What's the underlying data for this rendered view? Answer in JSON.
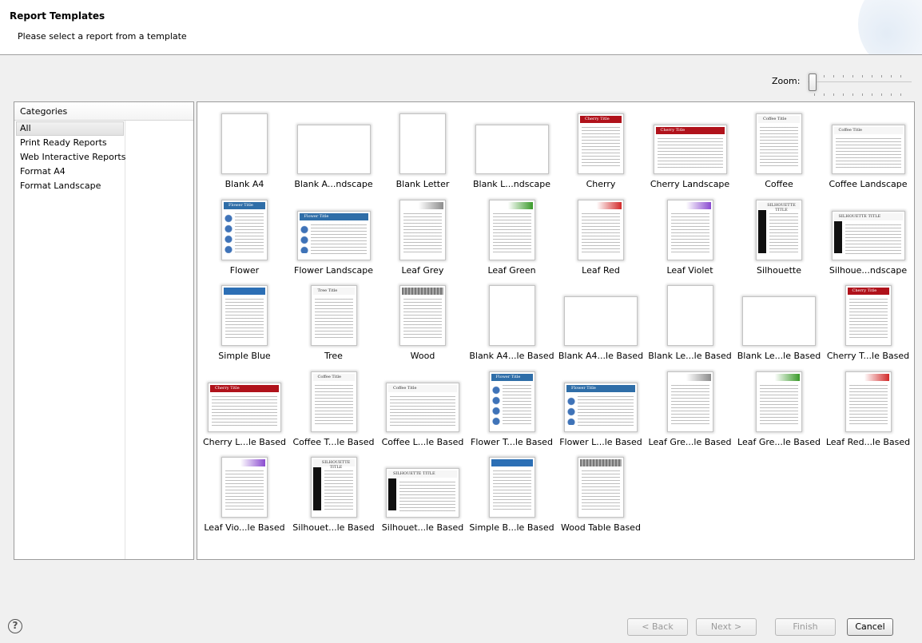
{
  "header": {
    "title": "Report Templates",
    "subtitle": "Please select a report from a template"
  },
  "zoom": {
    "label": "Zoom:",
    "level": 0
  },
  "categories": {
    "header": "Categories",
    "selected": "All",
    "items": [
      "All",
      "Print Ready Reports",
      "Web Interactive Reports",
      "Format A4",
      "Format Landscape"
    ]
  },
  "templates": [
    {
      "label": "Blank A4",
      "style": "blank",
      "orientation": "portrait"
    },
    {
      "label": "Blank A...ndscape",
      "style": "blank",
      "orientation": "landscape"
    },
    {
      "label": "Blank Letter",
      "style": "blank",
      "orientation": "portrait"
    },
    {
      "label": "Blank L...ndscape",
      "style": "blank",
      "orientation": "landscape"
    },
    {
      "label": "Cherry",
      "style": "cherry",
      "orientation": "portrait",
      "thumb_title": "Cherry Title"
    },
    {
      "label": "Cherry Landscape",
      "style": "cherry",
      "orientation": "landscape",
      "thumb_title": "Cherry Title"
    },
    {
      "label": "Coffee",
      "style": "coffee",
      "orientation": "portrait",
      "thumb_title": "Coffee Title"
    },
    {
      "label": "Coffee Landscape",
      "style": "coffee",
      "orientation": "landscape",
      "thumb_title": "Coffee Title"
    },
    {
      "label": "Flower",
      "style": "flower",
      "orientation": "portrait",
      "thumb_title": "Flower Title"
    },
    {
      "label": "Flower Landscape",
      "style": "flower",
      "orientation": "landscape",
      "thumb_title": "Flower Title"
    },
    {
      "label": "Leaf Grey",
      "style": "leaf-grey",
      "orientation": "portrait"
    },
    {
      "label": "Leaf Green",
      "style": "leaf-green",
      "orientation": "portrait"
    },
    {
      "label": "Leaf Red",
      "style": "leaf-red",
      "orientation": "portrait"
    },
    {
      "label": "Leaf Violet",
      "style": "leaf-violet",
      "orientation": "portrait"
    },
    {
      "label": "Silhouette",
      "style": "silhouette",
      "orientation": "portrait",
      "thumb_title": "SILHOUETTE TITLE"
    },
    {
      "label": "Silhoue...ndscape",
      "style": "silhouette",
      "orientation": "landscape",
      "thumb_title": "SILHOUETTE TITLE"
    },
    {
      "label": "Simple Blue",
      "style": "simple-blue",
      "orientation": "portrait"
    },
    {
      "label": "Tree",
      "style": "tree",
      "orientation": "portrait",
      "thumb_title": "Tree Title"
    },
    {
      "label": "Wood",
      "style": "wood",
      "orientation": "portrait"
    },
    {
      "label": "Blank A4...le Based",
      "style": "blank",
      "orientation": "portrait"
    },
    {
      "label": "Blank A4...le Based",
      "style": "blank",
      "orientation": "landscape"
    },
    {
      "label": "Blank Le...le Based",
      "style": "blank",
      "orientation": "portrait"
    },
    {
      "label": "Blank Le...le Based",
      "style": "blank",
      "orientation": "landscape"
    },
    {
      "label": "Cherry T...le Based",
      "style": "cherry",
      "orientation": "portrait",
      "thumb_title": "Cherry Title"
    },
    {
      "label": "Cherry L...le Based",
      "style": "cherry",
      "orientation": "landscape",
      "thumb_title": "Cherry Title"
    },
    {
      "label": "Coffee T...le Based",
      "style": "coffee",
      "orientation": "portrait",
      "thumb_title": "Coffee Title"
    },
    {
      "label": "Coffee L...le Based",
      "style": "coffee",
      "orientation": "landscape",
      "thumb_title": "Coffee Title"
    },
    {
      "label": "Flower T...le Based",
      "style": "flower",
      "orientation": "portrait",
      "thumb_title": "Flower Title"
    },
    {
      "label": "Flower L...le Based",
      "style": "flower",
      "orientation": "landscape",
      "thumb_title": "Flower Title"
    },
    {
      "label": "Leaf Gre...le Based",
      "style": "leaf-grey",
      "orientation": "portrait"
    },
    {
      "label": "Leaf Gre...le Based",
      "style": "leaf-green",
      "orientation": "portrait"
    },
    {
      "label": "Leaf Red...le Based",
      "style": "leaf-red",
      "orientation": "portrait"
    },
    {
      "label": "Leaf Vio...le Based",
      "style": "leaf-violet",
      "orientation": "portrait"
    },
    {
      "label": "Silhouet...le Based",
      "style": "silhouette",
      "orientation": "portrait",
      "thumb_title": "SILHOUETTE TITLE"
    },
    {
      "label": "Silhouet...le Based",
      "style": "silhouette",
      "orientation": "landscape",
      "thumb_title": "SILHOUETTE TITLE"
    },
    {
      "label": "Simple B...le Based",
      "style": "simple-blue",
      "orientation": "portrait"
    },
    {
      "label": "Wood Table Based",
      "style": "wood",
      "orientation": "portrait"
    }
  ],
  "style_colors": {
    "cherry": "#b0121b",
    "coffee": "#5a3a22",
    "flower": "#2f6ea8",
    "leaf-grey": "#8c8c8c",
    "leaf-green": "#3a9a2a",
    "leaf-red": "#d22a2a",
    "leaf-violet": "#8a4bd0",
    "silhouette": "#111111",
    "simple-blue": "#2c6fb5",
    "tree": "#5a5a5a",
    "wood": "#7a7a7a"
  },
  "footer": {
    "help_icon": "help-icon",
    "help_glyph": "?",
    "back_label": "< Back",
    "next_label": "Next >",
    "finish_label": "Finish",
    "cancel_label": "Cancel"
  }
}
